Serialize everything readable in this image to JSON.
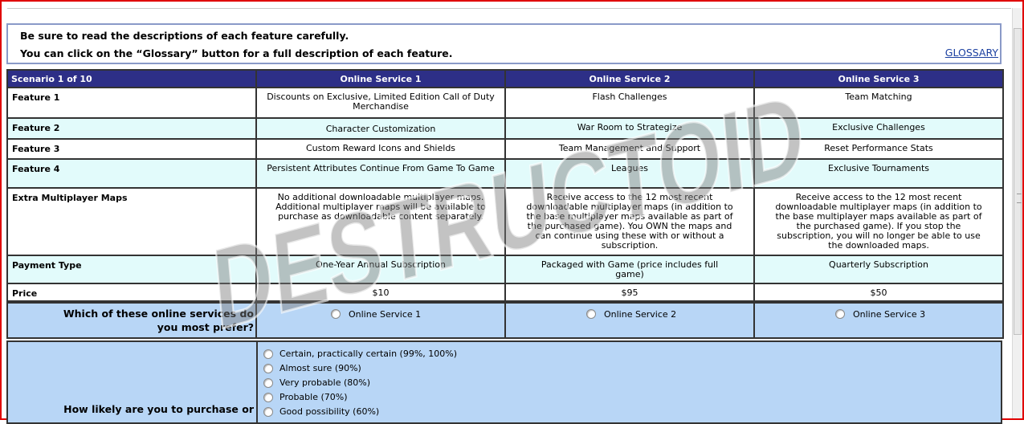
{
  "info": {
    "line1": "Be sure to read the descriptions of each feature carefully.",
    "line2": "You can click on the “Glossary” button for a full description of each feature.",
    "glossary_label": "GLOSSARY"
  },
  "table": {
    "scenario_label": "Scenario 1 of 10",
    "services": [
      "Online Service 1",
      "Online Service 2",
      "Online Service 3"
    ],
    "rows": [
      {
        "label": "Feature 1",
        "values": [
          "Discounts on Exclusive, Limited Edition Call of Duty Merchandise",
          "Flash Challenges",
          "Team Matching"
        ]
      },
      {
        "label": "Feature 2",
        "values": [
          "Character Customization",
          "War Room to Strategize",
          "Exclusive Challenges"
        ]
      },
      {
        "label": "Feature 3",
        "values": [
          "Custom Reward Icons and Shields",
          "Team Management and Support",
          "Reset Performance Stats"
        ]
      },
      {
        "label": "Feature 4",
        "values": [
          "Persistent Attributes Continue From Game To Game",
          "Leagues",
          "Exclusive Tournaments"
        ]
      },
      {
        "label": "Extra Multiplayer Maps",
        "values": [
          "No additional downloadable multiplayer maps. Additional multiplayer maps will be available to purchase as downloadable content separately.",
          "Receive access to the 12 most recent downloadable multiplayer maps (in addition to the base multiplayer maps available as part of the purchased game). You OWN the maps and can continue using these with or without a subscription.",
          "Receive access to the 12 most recent downloadable multiplayer maps (in addition to the base multiplayer maps available as part of the purchased game). If you stop the subscription, you will no longer be able to use the downloaded maps."
        ]
      },
      {
        "label": "Payment Type",
        "values": [
          "One-Year Annual Subscription",
          "Packaged with Game (price includes full game)",
          "Quarterly Subscription"
        ]
      },
      {
        "label": "Price",
        "values": [
          "$10",
          "$95",
          "$50"
        ]
      }
    ]
  },
  "preference": {
    "question_line1": "Which of these online services do",
    "question_line2": "you most prefer?",
    "options": [
      "Online Service 1",
      "Online Service 2",
      "Online Service 3"
    ]
  },
  "likelihood": {
    "question": "How likely are you to purchase or",
    "options": [
      "Certain, practically certain (99%, 100%)",
      "Almost sure (90%)",
      "Very probable (80%)",
      "Probable (70%)",
      "Good possibility (60%)"
    ]
  },
  "watermark_text": "DESTRUCTOID"
}
